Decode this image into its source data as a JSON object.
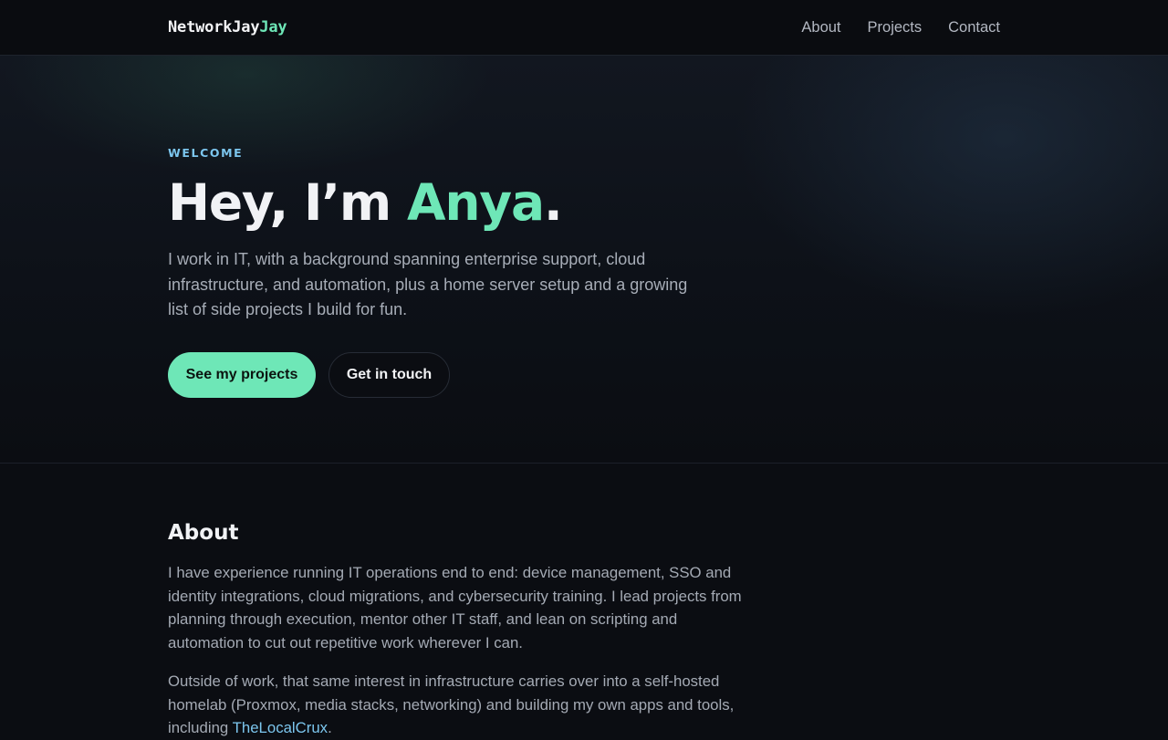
{
  "nav": {
    "brand_primary": "NetworkJay",
    "brand_accent": "Jay",
    "links": [
      {
        "label": "About"
      },
      {
        "label": "Projects"
      },
      {
        "label": "Contact"
      }
    ]
  },
  "hero": {
    "eyebrow": "WELCOME",
    "headline_prefix": "Hey, I’m ",
    "headline_name": "Anya",
    "headline_suffix": ".",
    "intro": "I work in IT, with a background spanning enterprise support, cloud infrastructure, and automation, plus a home server setup and a growing list of side projects I build for fun.",
    "primary_button": "See my projects",
    "secondary_button": "Get in touch"
  },
  "about": {
    "title": "About",
    "paragraph_1": "I have experience running IT operations end to end: device management, SSO and identity integrations, cloud migrations, and cybersecurity training. I lead projects from planning through execution, mentor other IT staff, and lean on scripting and automation to cut out repetitive work wherever I can.",
    "paragraph_2_text": "Outside of work, that same interest in infrastructure carries over into a self-hosted homelab (Proxmox, media stacks, networking) and building my own apps and tools, including ",
    "paragraph_2_link": "TheLocalCrux",
    "paragraph_2_end": "."
  },
  "colors": {
    "accent_green": "#6ee7b7",
    "accent_blue": "#7cc6ee",
    "background": "#0b0d12"
  }
}
